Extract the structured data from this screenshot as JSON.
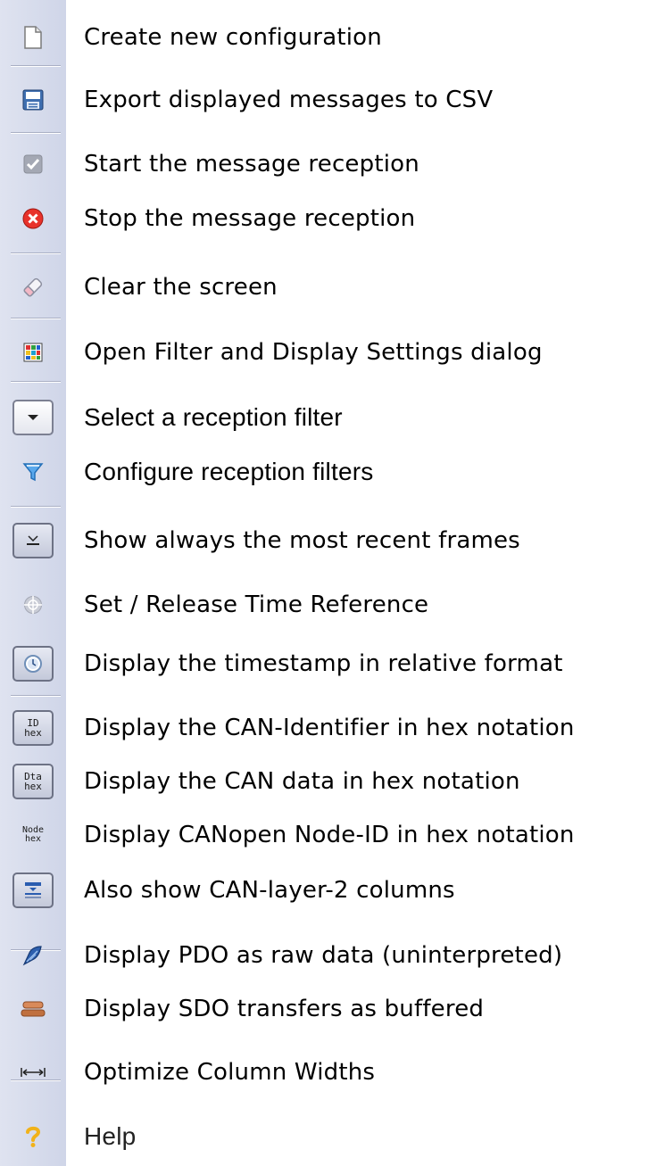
{
  "items": [
    {
      "label": "Create new configuration",
      "icon": "new-file-icon"
    },
    {
      "label": "Export displayed messages to CSV",
      "icon": "export-csv-icon"
    },
    {
      "label": "Start the message reception",
      "icon": "start-checkbox-icon"
    },
    {
      "label": "Stop the message reception",
      "icon": "stop-icon"
    },
    {
      "label": "Clear the screen",
      "icon": "eraser-icon"
    },
    {
      "label": "Open Filter and Display Settings dialog",
      "icon": "filter-settings-icon"
    },
    {
      "label": "Select a reception filter",
      "icon": "dropdown-icon"
    },
    {
      "label": "Configure reception filters",
      "icon": "funnel-icon"
    },
    {
      "label": "Show always the most recent frames",
      "icon": "scroll-bottom-icon"
    },
    {
      "label": "Set / Release Time Reference",
      "icon": "time-reference-icon"
    },
    {
      "label": "Display the timestamp in relative format",
      "icon": "clock-icon"
    },
    {
      "label": "Display the CAN-Identifier in hex notation",
      "icon": "id-hex-icon",
      "icon_text": [
        "ID",
        "hex"
      ]
    },
    {
      "label": "Display the CAN data in hex notation",
      "icon": "data-hex-icon",
      "icon_text": [
        "Dta",
        "hex"
      ]
    },
    {
      "label": "Display CANopen Node-ID in hex notation",
      "icon": "node-hex-icon",
      "icon_text": [
        "Node",
        "hex"
      ]
    },
    {
      "label": "Also show CAN-layer-2 columns",
      "icon": "columns-icon"
    },
    {
      "label": "Display PDO as raw data (uninterpreted)",
      "icon": "pdo-raw-icon"
    },
    {
      "label": "Display SDO transfers as buffered",
      "icon": "sdo-buffer-icon"
    },
    {
      "label": "Optimize Column Widths",
      "icon": "column-width-icon"
    },
    {
      "label": "Help",
      "icon": "help-icon"
    }
  ]
}
